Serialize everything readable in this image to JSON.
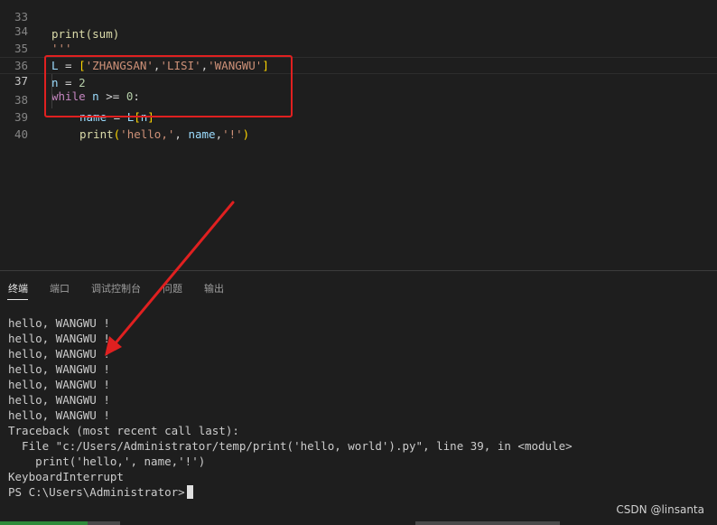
{
  "editor": {
    "lines": [
      {
        "n": "33",
        "text": "print(sum)"
      },
      {
        "n": "34",
        "text": "'''"
      },
      {
        "n": "35",
        "text": "L = ['ZHANGSAN','LISI','WANGWU']"
      },
      {
        "n": "36",
        "text": "n = 2"
      },
      {
        "n": "37",
        "text": "while n >= 0:"
      },
      {
        "n": "38",
        "text": "name = L[n]"
      },
      {
        "n": "39",
        "text": "print('hello,', name,'!')"
      },
      {
        "n": "40",
        "text": ""
      }
    ],
    "current_line": "37"
  },
  "panel": {
    "tabs": [
      "终端",
      "端口",
      "调试控制台",
      "问题",
      "输出"
    ],
    "active_tab": "终端"
  },
  "terminal": {
    "lines": [
      "hello, WANGWU !",
      "hello, WANGWU !",
      "hello, WANGWU !",
      "hello, WANGWU !",
      "hello, WANGWU !",
      "hello, WANGWU !",
      "hello, WANGWU !",
      "Traceback (most recent call last):",
      "  File \"c:/Users/Administrator/temp/print('hello, world').py\", line 39, in <module>",
      "    print('hello,', name,'!')",
      "KeyboardInterrupt"
    ],
    "prompt": "PS C:\\Users\\Administrator>"
  },
  "watermark": "CSDN @linsanta",
  "colors": {
    "annotation_red": "#e02020",
    "editor_bg": "#1e1e1e",
    "keyword": "#c586c0",
    "string": "#ce9178"
  }
}
